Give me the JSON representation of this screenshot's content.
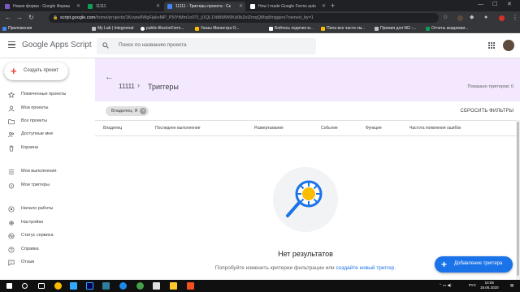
{
  "browser": {
    "tabs": [
      {
        "title": "Новая форма - Google Формы",
        "active": false,
        "favicon_color": "#7e57c2"
      },
      {
        "title": "11111",
        "active": false,
        "favicon_color": "#0f9d58"
      },
      {
        "title": "11111 - Триггеры проекта - Ск",
        "active": true,
        "favicon_color": "#4285f4"
      },
      {
        "title": "How I made Google Forms auto",
        "active": false,
        "favicon_color": "#ffffff"
      }
    ],
    "url_host": "script.google.com",
    "url_path": "/home/projects/1Kcww8WgFjakxMP_P5lYtMm1o0TI_ji1QL1NtBMW9Kd0bZelZmqQMqd/triggers?owned_by=1",
    "bookmarks": [
      {
        "label": "Приложения",
        "color": "#4285f4"
      },
      {
        "label": "My Lab | Integromat",
        "color": "#4a4c50"
      },
      {
        "label": "public-files/onForm...",
        "color": "#ffffff"
      },
      {
        "label": "Указы Министра О...",
        "color": "#fbbc04"
      },
      {
        "label": "Бойтесь ходячих м...",
        "color": "#ffffff"
      },
      {
        "label": "Пила все части см...",
        "color": "#fbbc04"
      },
      {
        "label": "Премия для NG -...",
        "color": "#4a4c50"
      },
      {
        "label": "Отчеты академии...",
        "color": "#0f9d58"
      }
    ]
  },
  "app": {
    "logo": "Google Apps Script",
    "search_placeholder": "Поиск по названию проекта",
    "create_label": "Создать проект"
  },
  "sidebar": {
    "items": [
      {
        "label": "Помеченные проекты",
        "icon": "star-icon"
      },
      {
        "label": "Мои проекты",
        "icon": "person-icon"
      },
      {
        "label": "Все проекты",
        "icon": "folder-icon"
      },
      {
        "label": "Доступные мне",
        "icon": "people-icon"
      },
      {
        "label": "Корзина",
        "icon": "trash-icon"
      },
      {
        "label": "Мои выполнения",
        "icon": "list-icon"
      },
      {
        "label": "Мои триггеры",
        "icon": "alarm-icon"
      },
      {
        "label": "Начало работы",
        "icon": "help-icon"
      },
      {
        "label": "Настройки",
        "icon": "gear-icon"
      },
      {
        "label": "Статус сервиса",
        "icon": "pulse-icon"
      },
      {
        "label": "Справка",
        "icon": "question-icon"
      },
      {
        "label": "Отзыв",
        "icon": "feedback-icon"
      }
    ]
  },
  "main": {
    "breadcrumb_project": "11111",
    "breadcrumb_page": "Триггеры",
    "shown_count": "Показано триггеров: 0",
    "filter_chip": "Владелец: Я",
    "reset_filters": "СБРОСИТЬ ФИЛЬТРЫ",
    "columns": [
      "Владелец",
      "Последнее выполнение",
      "Развертывание",
      "Событие",
      "Функция",
      "Частота появления ошибок"
    ],
    "empty_title": "Нет результатов",
    "empty_hint": "Попробуйте изменить критерии фильтрации или",
    "empty_link": "создайте новый триггер.",
    "fab_label": "Добавление триггера"
  },
  "taskbar": {
    "lang": "РУС",
    "time": "10:05",
    "date": "18.06.2020"
  },
  "colors": {
    "accent": "#1a73e8",
    "band": "#f3e8fd"
  }
}
